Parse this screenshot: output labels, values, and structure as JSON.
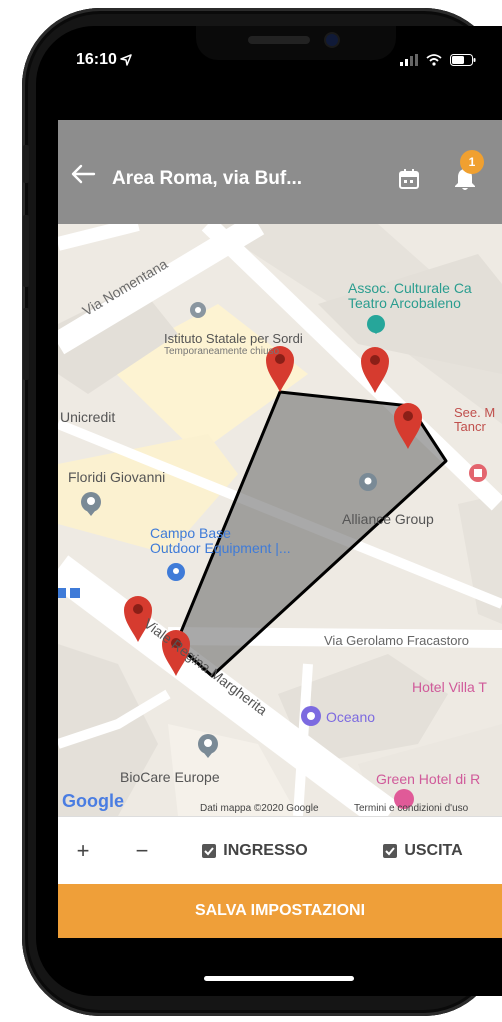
{
  "status_bar": {
    "time": "16:10"
  },
  "app_bar": {
    "title": "Area Roma, via Buf...",
    "notification_count": "1"
  },
  "map": {
    "labels": {
      "via_nomentana": "Via Nomentana",
      "assoc_line1": "Assoc. Culturale Ca",
      "assoc_line2": "Teatro Arcobaleno",
      "istituto_line1": "Istituto Statale per Sordi",
      "istituto_line2": "Temporaneamente chiuso",
      "unicredit": "Unicredit",
      "see_line1": "See. M",
      "see_line2": "Tancr",
      "floridi": "Floridi Giovanni",
      "alliance": "Alliance Group",
      "campo_line1": "Campo Base",
      "campo_line2": "Outdoor Equipment |...",
      "via_regina": "Viale Regina Margherita",
      "via_gerolamo": "Via Gerolamo Fracastoro",
      "hotel_villa": "Hotel Villa T",
      "oceano": "Oceano",
      "biocare": "BioCare Europe",
      "green_hotel": "Green Hotel di R",
      "google": "Google",
      "copyright": "Dati mappa ©2020 Google",
      "terms": "Termini e condizioni d'uso"
    }
  },
  "controls": {
    "zoom_in": "+",
    "zoom_out": "−",
    "ingresso": "INGRESSO",
    "uscita": "USCITA"
  },
  "save_button": "SALVA IMPOSTAZIONI",
  "colors": {
    "accent": "#ef9f39",
    "appbar": "#8d8d8d",
    "marker": "#d63b2f"
  }
}
